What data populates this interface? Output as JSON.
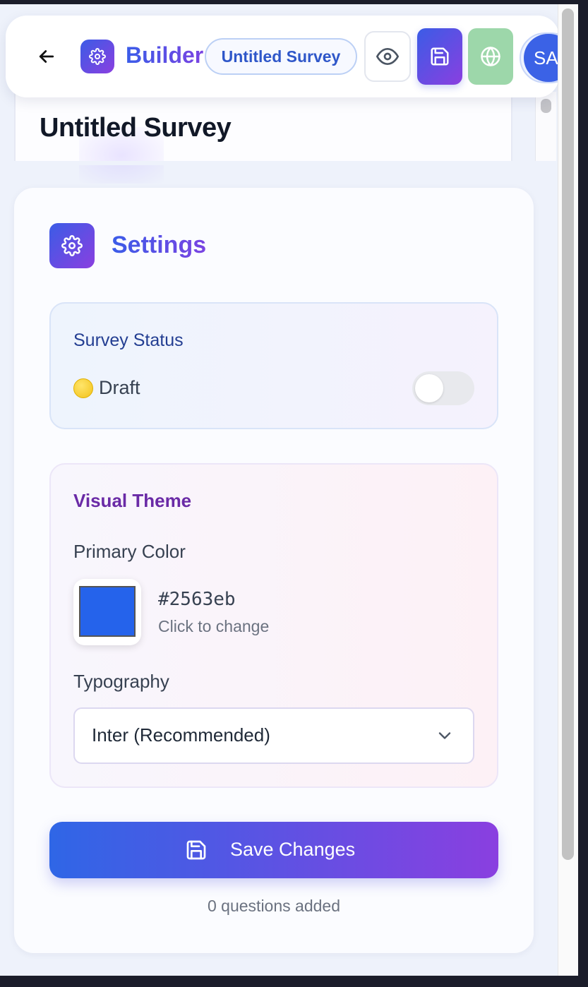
{
  "header": {
    "brand": "Builder",
    "survey_name": "Untitled Survey",
    "avatar_initials": "SA",
    "icons": {
      "back": "arrow-left-icon",
      "brand": "gear-icon",
      "preview": "eye-icon",
      "save": "floppy-disk-icon",
      "publish": "globe-icon"
    }
  },
  "page": {
    "title": "Untitled Survey"
  },
  "settings": {
    "title": "Settings",
    "icon": "gear-icon",
    "status": {
      "heading": "Survey Status",
      "value": "Draft",
      "dot_color": "#facc15",
      "published": false
    },
    "theme": {
      "heading": "Visual Theme",
      "primary_color_label": "Primary Color",
      "primary_color": "#2563eb",
      "primary_color_hint": "Click to change",
      "typography_label": "Typography",
      "font_selected": "Inter (Recommended)"
    },
    "save_label": "Save Changes",
    "question_count_text": "0 questions added"
  },
  "colors": {
    "accent_start": "#3b5ce6",
    "accent_end": "#8a3fe0",
    "publish_green": "#9dd7aa"
  }
}
